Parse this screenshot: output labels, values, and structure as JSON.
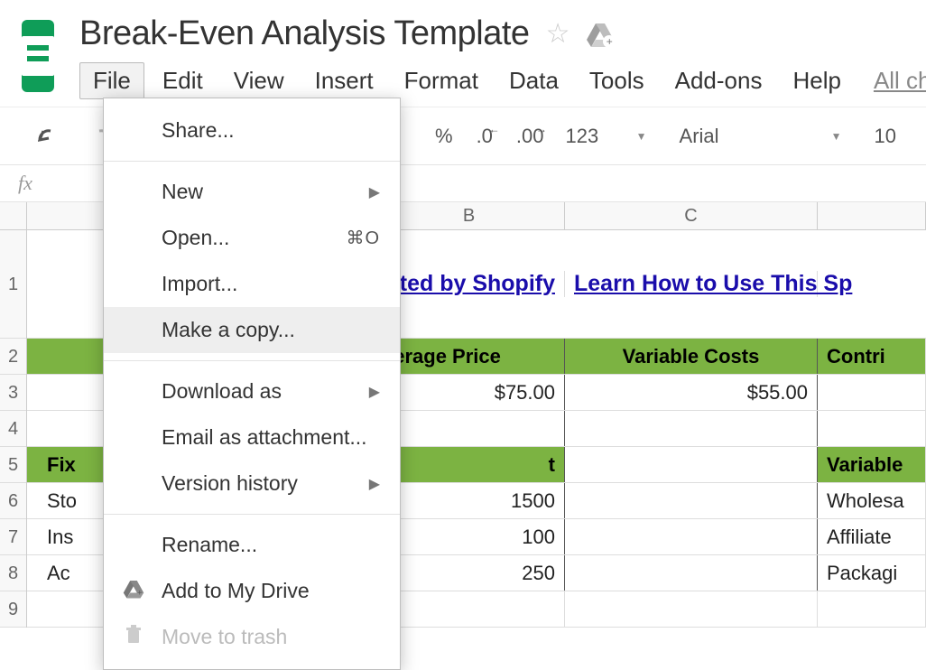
{
  "doc": {
    "title": "Break-Even Analysis Template"
  },
  "menubar": {
    "items": [
      "File",
      "Edit",
      "View",
      "Insert",
      "Format",
      "Data",
      "Tools",
      "Add-ons",
      "Help"
    ],
    "status": "All changes"
  },
  "toolbar": {
    "percent": "%",
    "dec_less": ".0",
    "dec_more": ".00",
    "num_format": "123",
    "font": "Arial",
    "font_size": "10"
  },
  "file_menu": {
    "share": "Share...",
    "new": "New",
    "open": "Open...",
    "open_shortcut": "⌘O",
    "import": "Import...",
    "make_copy": "Make a copy...",
    "download_as": "Download as",
    "email_attachment": "Email as attachment...",
    "version_history": "Version history",
    "rename": "Rename...",
    "add_to_drive": "Add to My Drive",
    "move_to_trash": "Move to trash"
  },
  "columns": {
    "B": "B",
    "C": "C"
  },
  "row_numbers": [
    "1",
    "2",
    "3",
    "4",
    "5",
    "6",
    "7",
    "8",
    "9"
  ],
  "sheet": {
    "row1": {
      "b_link": "ted by Shopify",
      "c_link": "Learn How to Use This Sp"
    },
    "row2": {
      "a_partial": "",
      "b": "verage Price",
      "c": "Variable Costs",
      "d": "Contri"
    },
    "row3": {
      "b": "$75.00",
      "c": "$55.00"
    },
    "row5": {
      "a": "Fix",
      "b_partial": "t",
      "d": "Variable"
    },
    "row6": {
      "a": "Sto",
      "b": "1500",
      "d": "Wholesa"
    },
    "row7": {
      "a": "Ins",
      "b": "100",
      "d": "Affiliate"
    },
    "row8": {
      "a": "Ac",
      "b": "250",
      "d": "Packagi"
    }
  }
}
